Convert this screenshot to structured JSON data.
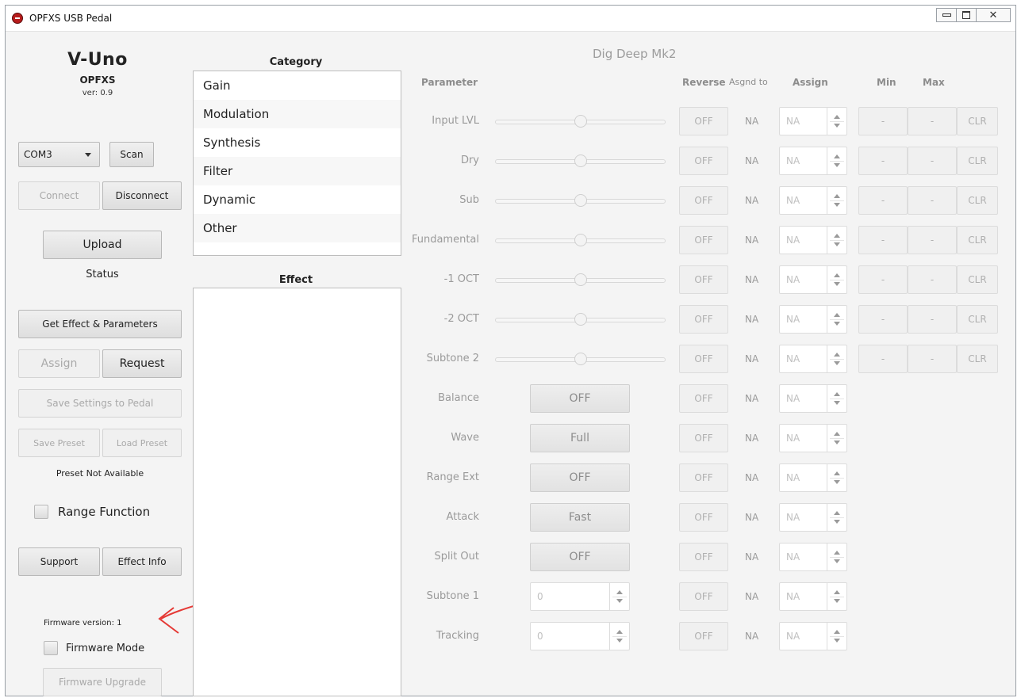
{
  "window": {
    "title": "OPFXS USB Pedal"
  },
  "brand": {
    "product": "V-Uno",
    "company": "OPFXS",
    "version": "ver: 0.9"
  },
  "left": {
    "port_selected": "COM3",
    "scan_label": "Scan",
    "connect_label": "Connect",
    "disconnect_label": "Disconnect",
    "upload_label": "Upload",
    "status_label": "Status",
    "get_effect_label": "Get Effect & Parameters",
    "assign_label": "Assign",
    "request_label": "Request",
    "save_settings_label": "Save Settings to Pedal",
    "save_preset_label": "Save Preset",
    "load_preset_label": "Load Preset",
    "preset_status": "Preset Not Available",
    "range_function_label": "Range Function",
    "support_label": "Support",
    "effect_info_label": "Effect Info",
    "firmware_version": "Firmware version: 1",
    "firmware_mode_label": "Firmware Mode",
    "firmware_upgrade_label": "Firmware Upgrade"
  },
  "category": {
    "title": "Category",
    "items": [
      "Gain",
      "Modulation",
      "Synthesis",
      "Filter",
      "Dynamic",
      "Other"
    ]
  },
  "effect": {
    "title": "Effect"
  },
  "right": {
    "effect_name": "Dig Deep Mk2",
    "headers": {
      "parameter": "Parameter",
      "reverse": "Reverse",
      "assigned_to": "Asgnd to",
      "assign": "Assign",
      "min": "Min",
      "max": "Max"
    },
    "off_label": "OFF",
    "na_label": "NA",
    "dash_label": "-",
    "clr_label": "CLR",
    "slider_params": [
      {
        "label": "Input LVL",
        "value": 0.5
      },
      {
        "label": "Dry",
        "value": 0.5
      },
      {
        "label": "Sub",
        "value": 0.5
      },
      {
        "label": "Fundamental",
        "value": 0.5
      },
      {
        "label": "-1 OCT",
        "value": 0.5
      },
      {
        "label": "-2 OCT",
        "value": 0.5
      },
      {
        "label": "Subtone 2",
        "value": 0.5
      }
    ],
    "toggle_params": [
      {
        "label": "Balance",
        "value": "OFF"
      },
      {
        "label": "Wave",
        "value": "Full"
      },
      {
        "label": "Range Ext",
        "value": "OFF"
      },
      {
        "label": "Attack",
        "value": "Fast"
      },
      {
        "label": "Split Out",
        "value": "OFF"
      }
    ],
    "spinner_params": [
      {
        "label": "Subtone 1",
        "value": "0"
      },
      {
        "label": "Tracking",
        "value": "0"
      }
    ]
  },
  "colors": {
    "annotation": "#e53935",
    "app_icon": "#b71c1c"
  }
}
